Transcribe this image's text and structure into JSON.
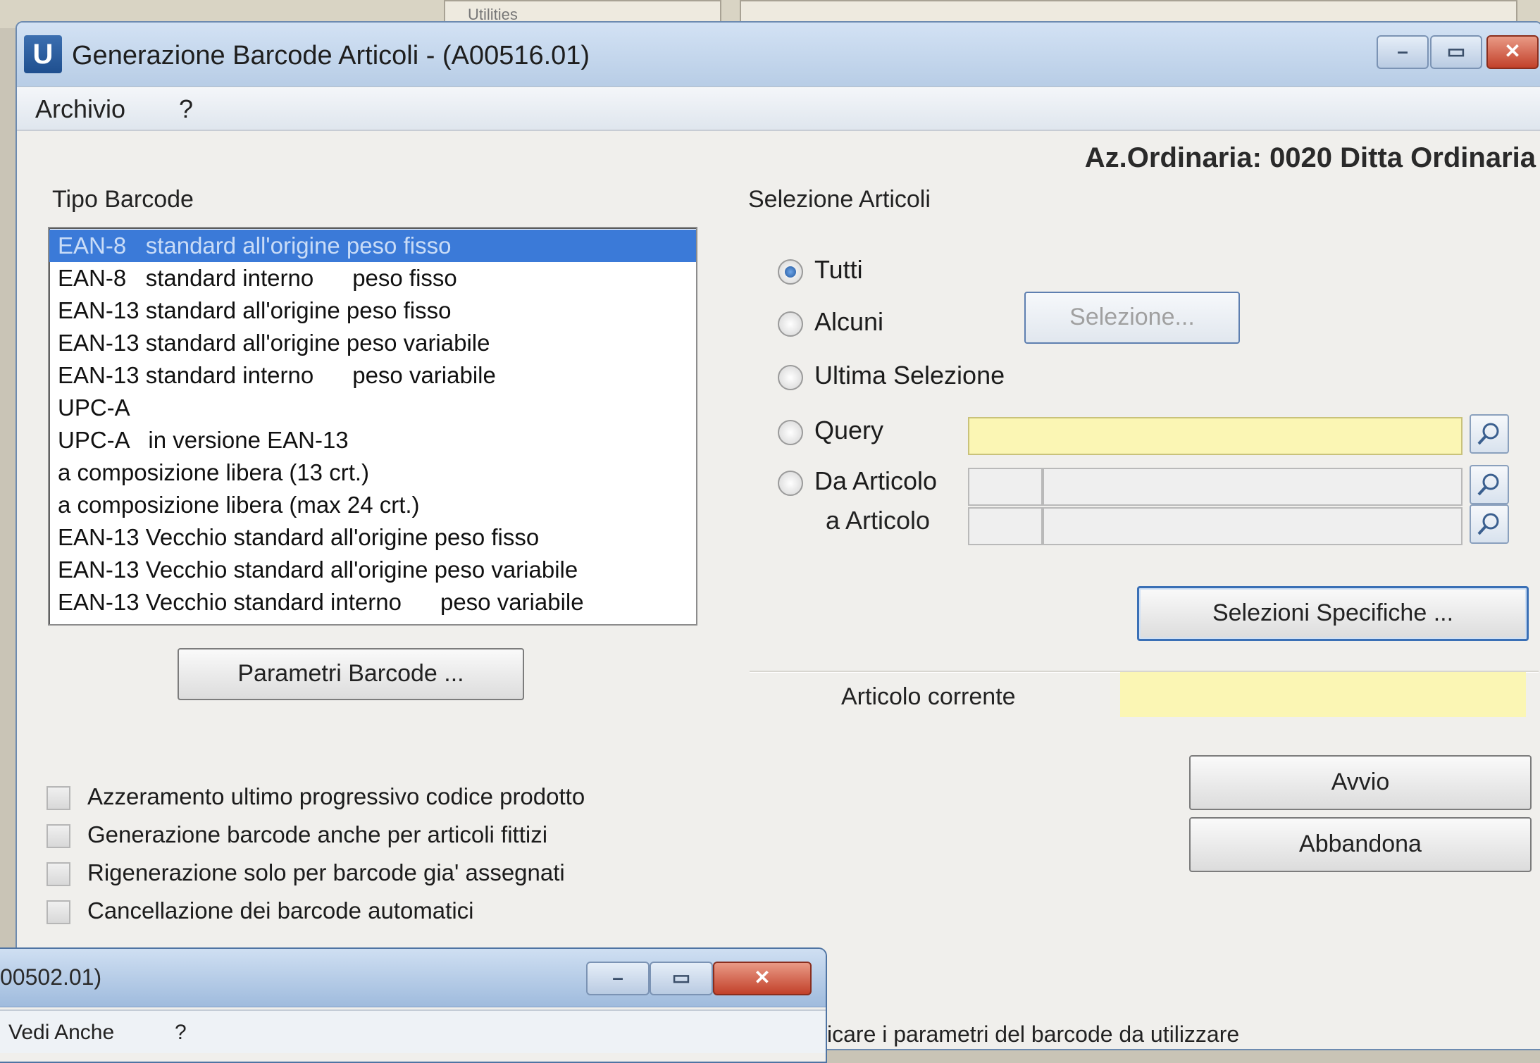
{
  "main_window": {
    "title": "Generazione Barcode Articoli - (A00516.01)",
    "icon": "app-icon",
    "menu": [
      "Archivio",
      "?"
    ],
    "controls": {
      "minimize": "–",
      "maximize": "▭",
      "close": "✕"
    }
  },
  "company_label": "Az.Ordinaria: 0020 Ditta Ordinaria",
  "tipo_barcode": {
    "label": "Tipo Barcode",
    "items": [
      "EAN-8   standard all'origine peso fisso",
      "EAN-8   standard interno      peso fisso",
      "EAN-13 standard all'origine peso fisso",
      "EAN-13 standard all'origine peso variabile",
      "EAN-13 standard interno      peso variabile",
      "UPC-A",
      "UPC-A   in versione EAN-13",
      "a composizione libera (13 crt.)",
      "a composizione libera (max 24 crt.)",
      "EAN-13 Vecchio standard all'origine peso fisso",
      "EAN-13 Vecchio standard all'origine peso variabile",
      "EAN-13 Vecchio standard interno      peso variabile"
    ],
    "selected_index": 0
  },
  "buttons": {
    "parametri": "Parametri Barcode ...",
    "selezione": "Selezione...",
    "selezioni_specifiche": "Selezioni Specifiche ...",
    "avvio": "Avvio",
    "abbandona": "Abbandona"
  },
  "options": [
    "Azzeramento ultimo progressivo codice prodotto",
    "Generazione barcode anche per articoli fittizi",
    "Rigenerazione solo per barcode gia' assegnati",
    "Cancellazione dei barcode automatici"
  ],
  "selezione_articoli": {
    "label": "Selezione Articoli",
    "radios": [
      "Tutti",
      "Alcuni",
      "Ultima Selezione",
      "Query",
      "Da  Articolo"
    ],
    "selected": "Tutti",
    "a_articolo_label": "a  Articolo",
    "query_value": ""
  },
  "articolo_corrente": {
    "label": "Articolo corrente",
    "value": ""
  },
  "status_bar": "icare i parametri del barcode da utilizzare",
  "background_strip": {
    "text": "Utilities"
  },
  "second_window": {
    "title": "00502.01)",
    "menu": [
      "Vedi Anche",
      "?"
    ],
    "controls": {
      "minimize": "–",
      "maximize": "▭",
      "close": "✕"
    }
  },
  "colors": {
    "selection": "#3b7ad8",
    "yellow_field": "#fbf6b4",
    "title_bar": "#c3d6ee"
  }
}
